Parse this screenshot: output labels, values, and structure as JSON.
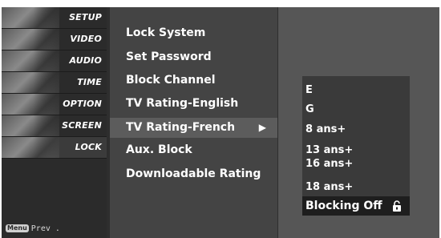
{
  "side_menu": {
    "items": [
      {
        "label": "SETUP"
      },
      {
        "label": "VIDEO"
      },
      {
        "label": "AUDIO"
      },
      {
        "label": "TIME"
      },
      {
        "label": "OPTION"
      },
      {
        "label": "SCREEN"
      },
      {
        "label": "LOCK"
      }
    ],
    "active_item": "LOCK",
    "prev_key": "Menu",
    "prev_label": "Prev ."
  },
  "lock_menu": {
    "items": [
      {
        "label": "Lock System"
      },
      {
        "label": "Set Password"
      },
      {
        "label": "Block Channel"
      },
      {
        "label": "TV Rating-English"
      },
      {
        "label": "TV Rating-French"
      },
      {
        "label": "Aux. Block"
      },
      {
        "label": "Downloadable Rating"
      }
    ],
    "selected_item": "TV Rating-French",
    "selected_arrow": "▶"
  },
  "rating_submenu": {
    "items": [
      {
        "label": "E"
      },
      {
        "label": "G"
      },
      {
        "label": "8 ans+"
      },
      {
        "label": "13 ans+"
      },
      {
        "label": "16 ans+"
      },
      {
        "label": "18 ans+"
      },
      {
        "label": "Blocking Off"
      }
    ],
    "selected_item": "Blocking Off",
    "selected_icon": "unlock-icon"
  },
  "colors": {
    "background": "#2e2e2e",
    "highlight": "#5c5c5c",
    "text": "#ffffff"
  }
}
